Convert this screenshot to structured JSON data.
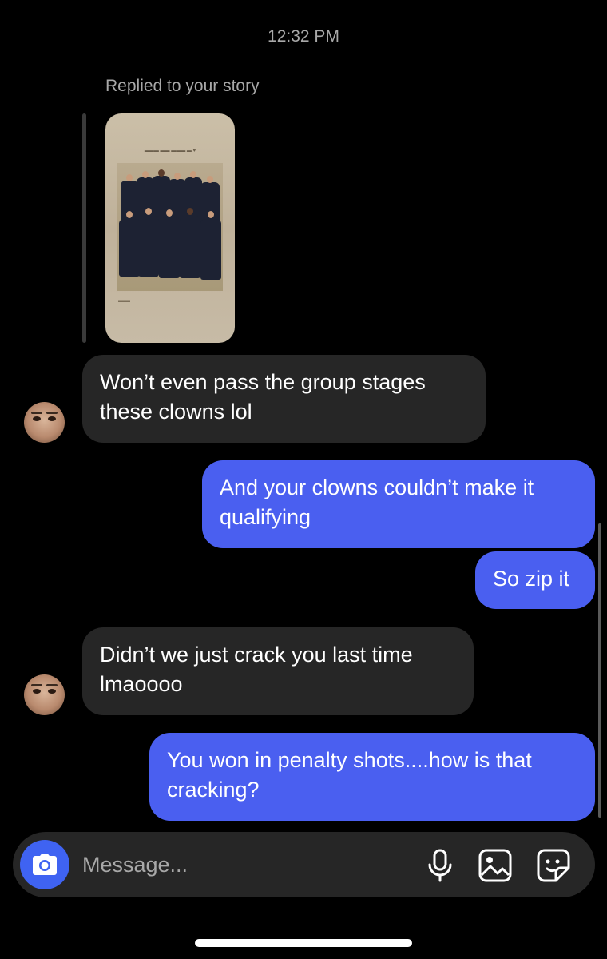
{
  "conversation": {
    "timestamp": "12:32 PM",
    "reply_label": "Replied to your story"
  },
  "messages": [
    {
      "direction": "incoming",
      "text": "Won’t even pass the group stages these clowns lol"
    },
    {
      "direction": "outgoing",
      "text": "And your clowns couldn’t make it qualifying"
    },
    {
      "direction": "outgoing",
      "text": "So zip it"
    },
    {
      "direction": "incoming",
      "text": "Didn’t we just crack you last time lmaoooo"
    },
    {
      "direction": "outgoing",
      "text": "You won in penalty shots....how is that cracking?"
    }
  ],
  "composer": {
    "placeholder": "Message...",
    "icons": [
      "camera-icon",
      "microphone-icon",
      "gallery-icon",
      "sticker-icon"
    ]
  },
  "colors": {
    "background": "#000000",
    "incoming_bubble": "#262626",
    "outgoing_bubble": "#4a5ff0",
    "camera_button": "#3f63f2",
    "meta_text": "#a8a8a8"
  }
}
